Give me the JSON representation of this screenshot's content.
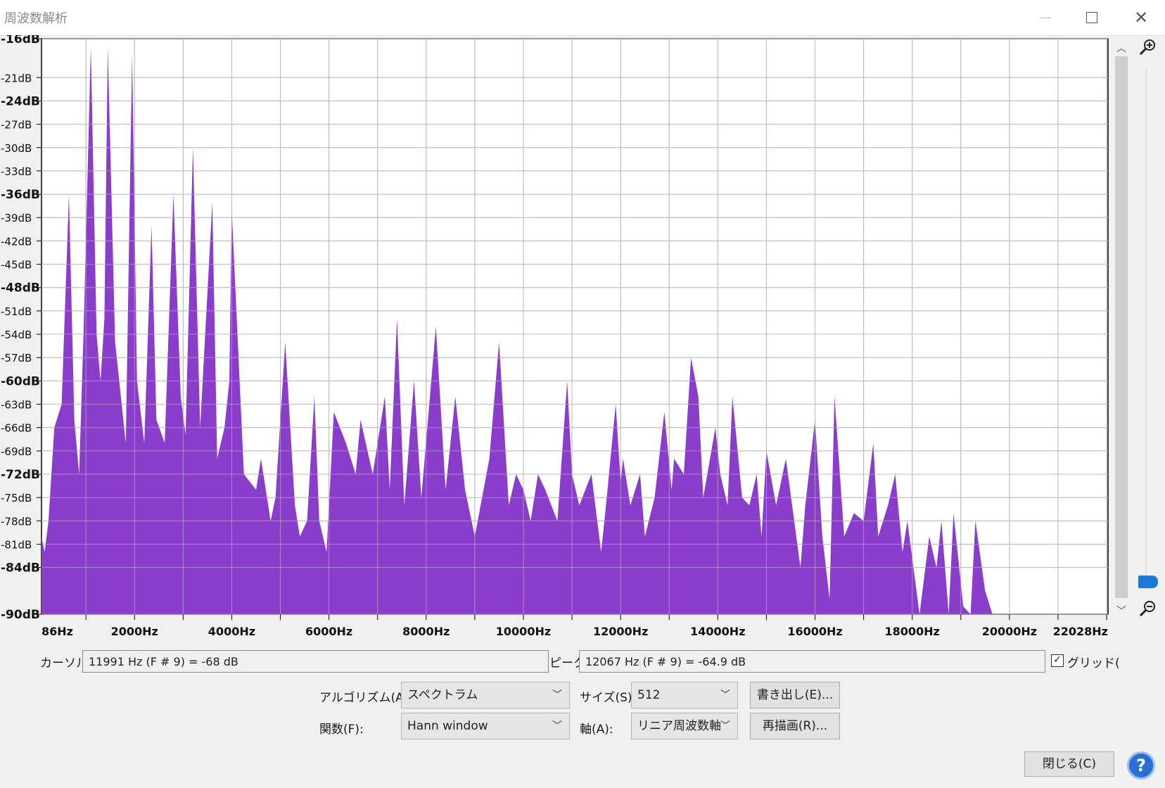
{
  "window": {
    "title": "周波数解析",
    "minimize_icon": "minimize-icon",
    "maximize_icon": "maximize-icon",
    "close_icon": "close-icon"
  },
  "colors": {
    "spectrum_fill": "#8a3ccb",
    "grid": "#a8a8a8",
    "plot_bg": "#ffffff",
    "accent_blue": "#1e78d6"
  },
  "chart_data": {
    "type": "area",
    "x_axis": {
      "unit": "Hz",
      "range": [
        86,
        22028
      ],
      "tick_labels": [
        {
          "value": 86,
          "label": "86Hz"
        },
        {
          "value": 2000,
          "label": "2000Hz"
        },
        {
          "value": 4000,
          "label": "4000Hz"
        },
        {
          "value": 6000,
          "label": "6000Hz"
        },
        {
          "value": 8000,
          "label": "8000Hz"
        },
        {
          "value": 10000,
          "label": "10000Hz"
        },
        {
          "value": 12000,
          "label": "12000Hz"
        },
        {
          "value": 14000,
          "label": "14000Hz"
        },
        {
          "value": 16000,
          "label": "16000Hz"
        },
        {
          "value": 18000,
          "label": "18000Hz"
        },
        {
          "value": 20000,
          "label": "20000Hz"
        },
        {
          "value": 22028,
          "label": "22028Hz"
        }
      ],
      "grid_step_hz": 1000,
      "scale": "linear"
    },
    "y_axis": {
      "unit": "dB",
      "range": [
        -90,
        -16
      ],
      "tick_labels": [
        {
          "value": -16,
          "label": "-16dB",
          "major": true
        },
        {
          "value": -21,
          "label": "-21dB",
          "major": false
        },
        {
          "value": -24,
          "label": "-24dB",
          "major": true
        },
        {
          "value": -27,
          "label": "-27dB",
          "major": false
        },
        {
          "value": -30,
          "label": "-30dB",
          "major": false
        },
        {
          "value": -33,
          "label": "-33dB",
          "major": false
        },
        {
          "value": -36,
          "label": "-36dB",
          "major": true
        },
        {
          "value": -39,
          "label": "-39dB",
          "major": false
        },
        {
          "value": -42,
          "label": "-42dB",
          "major": false
        },
        {
          "value": -45,
          "label": "-45dB",
          "major": false
        },
        {
          "value": -48,
          "label": "-48dB",
          "major": true
        },
        {
          "value": -51,
          "label": "-51dB",
          "major": false
        },
        {
          "value": -54,
          "label": "-54dB",
          "major": false
        },
        {
          "value": -57,
          "label": "-57dB",
          "major": false
        },
        {
          "value": -60,
          "label": "-60dB",
          "major": true
        },
        {
          "value": -63,
          "label": "-63dB",
          "major": false
        },
        {
          "value": -66,
          "label": "-66dB",
          "major": false
        },
        {
          "value": -69,
          "label": "-69dB",
          "major": false
        },
        {
          "value": -72,
          "label": "-72dB",
          "major": true
        },
        {
          "value": -75,
          "label": "-75dB",
          "major": false
        },
        {
          "value": -78,
          "label": "-78dB",
          "major": false
        },
        {
          "value": -81,
          "label": "-81dB",
          "major": false
        },
        {
          "value": -84,
          "label": "-84dB",
          "major": true
        },
        {
          "value": -90,
          "label": "-90dB",
          "major": true
        }
      ]
    },
    "grid": true,
    "series": [
      {
        "x": [
          86,
          150,
          230,
          350,
          500,
          650,
          760,
          860,
          950,
          1100,
          1220,
          1300,
          1380,
          1450,
          1600,
          1820,
          1950,
          2050,
          2200,
          2350,
          2450,
          2620,
          2800,
          2950,
          3050,
          3200,
          3350,
          3600,
          3700,
          3850,
          3950,
          4000,
          4250,
          4500,
          4600,
          4800,
          4900,
          5100,
          5300,
          5400,
          5550,
          5700,
          5800,
          5950,
          6100,
          6350,
          6550,
          6650,
          6900,
          7150,
          7250,
          7400,
          7550,
          7750,
          7900,
          8200,
          8400,
          8600,
          8800,
          9000,
          9300,
          9500,
          9700,
          9850,
          10000,
          10150,
          10300,
          10450,
          10700,
          10900,
          11000,
          11150,
          11400,
          11600,
          11700,
          11900,
          12000,
          12050,
          12200,
          12400,
          12500,
          12700,
          12900,
          13050,
          13100,
          13300,
          13450,
          13600,
          13700,
          13950,
          14050,
          14200,
          14300,
          14500,
          14650,
          14800,
          14900,
          15000,
          15200,
          15400,
          15700,
          15800,
          16000,
          16150,
          16300,
          16400,
          16600,
          16800,
          17000,
          17200,
          17300,
          17500,
          17650,
          17800,
          17900,
          18150,
          18350,
          18500,
          18600,
          18750,
          18850,
          19050,
          19200,
          19300,
          19500,
          19650,
          19800,
          19950,
          20100,
          20200,
          20350,
          20450,
          20600,
          20750,
          20900,
          21000,
          21150,
          21300,
          21500,
          21700,
          22028
        ],
        "y": [
          -80,
          -82,
          -78,
          -66,
          -63,
          -36,
          -65,
          -72,
          -54,
          -17,
          -54,
          -60,
          -52,
          -17,
          -55,
          -68,
          -18,
          -60,
          -68,
          -40,
          -65,
          -68,
          -36,
          -62,
          -67,
          -30,
          -66,
          -37,
          -70,
          -66,
          -60,
          -38,
          -72,
          -74,
          -70,
          -78,
          -75,
          -55,
          -76,
          -80,
          -78,
          -62,
          -78,
          -82,
          -64,
          -68,
          -72,
          -65,
          -72,
          -62,
          -74,
          -52,
          -76,
          -60,
          -75,
          -53,
          -74,
          -62,
          -74,
          -80,
          -70,
          -55,
          -76,
          -72,
          -74,
          -78,
          -72,
          -74,
          -78,
          -60,
          -72,
          -76,
          -72,
          -82,
          -76,
          -63,
          -73,
          -70,
          -76,
          -72,
          -80,
          -75,
          -64,
          -74,
          -70,
          -72,
          -57,
          -62,
          -75,
          -66,
          -72,
          -76,
          -62,
          -75,
          -76,
          -72,
          -80,
          -69,
          -76,
          -70,
          -84,
          -76,
          -65,
          -80,
          -88,
          -62,
          -80,
          -77,
          -78,
          -68,
          -80,
          -76,
          -72,
          -82,
          -78,
          -90,
          -80,
          -84,
          -78,
          -90,
          -77,
          -89,
          -90,
          -78,
          -87,
          -90,
          -90,
          -90,
          -90,
          -90,
          -90,
          -90,
          -90,
          -90,
          -90,
          -90,
          -90,
          -90,
          -90,
          -90,
          -90
        ]
      }
    ]
  },
  "readouts": {
    "cursor_label": "カーソル:",
    "cursor_value": "11991 Hz (F # 9) = -68 dB",
    "peak_label": "ピーク:",
    "peak_value": "12067 Hz (F # 9) = -64.9 dB",
    "grid_label": "グリッド(",
    "grid_checked": "✓"
  },
  "controls": {
    "algorithm_label": "アルゴリズム(A):",
    "algorithm_value": "スペクトラム",
    "size_label": "サイズ(S):",
    "size_value": "512",
    "export_button": "書き出し(E)...",
    "function_label": "関数(F):",
    "function_value": "Hann window",
    "axis_label": "軸(A):",
    "axis_value": "リニア周波数軸",
    "replot_button": "再描画(R)...",
    "close_button": "閉じる(C)",
    "help_button": "?",
    "zoom_in_icon": "zoom-in-icon",
    "zoom_out_icon": "zoom-out-icon"
  }
}
